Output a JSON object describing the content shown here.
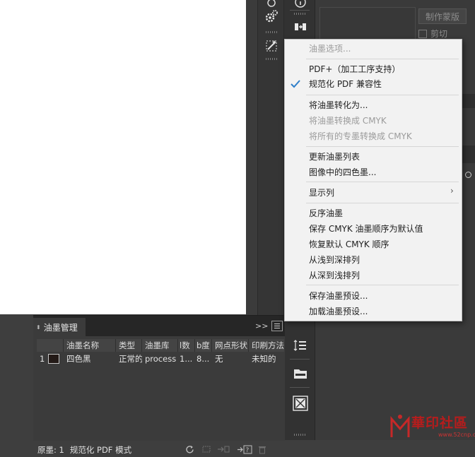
{
  "flyout_menu": {
    "items": [
      {
        "label": "油墨选项...",
        "enabled": false,
        "checked": false
      },
      {
        "label": "PDF+（加工工序支持）",
        "enabled": true,
        "checked": false
      },
      {
        "label": "规范化 PDF 兼容性",
        "enabled": true,
        "checked": true
      },
      {
        "label": "将油墨转化为...",
        "enabled": true,
        "checked": false
      },
      {
        "label": "将油墨转换成 CMYK",
        "enabled": false,
        "checked": false
      },
      {
        "label": "将所有的专墨转换成 CMYK",
        "enabled": false,
        "checked": false
      },
      {
        "label": "更新油墨列表",
        "enabled": true,
        "checked": false
      },
      {
        "label": "图像中的四色墨...",
        "enabled": true,
        "checked": false
      },
      {
        "label": "显示列",
        "enabled": true,
        "checked": false,
        "has_submenu": true
      },
      {
        "label": "反序油墨",
        "enabled": true,
        "checked": false
      },
      {
        "label": "保存 CMYK 油墨顺序为默认值",
        "enabled": true,
        "checked": false
      },
      {
        "label": "恢复默认 CMYK 顺序",
        "enabled": true,
        "checked": false
      },
      {
        "label": "从浅到深排列",
        "enabled": true,
        "checked": false
      },
      {
        "label": "从深到浅排列",
        "enabled": true,
        "checked": false
      },
      {
        "label": "保存油墨预设...",
        "enabled": true,
        "checked": false
      },
      {
        "label": "加载油墨预设...",
        "enabled": true,
        "checked": false
      }
    ]
  },
  "ink_panel": {
    "tab_title": "油墨管理",
    "collapse_glyph": ">>",
    "columns": [
      "油墨名称",
      "类型",
      "油墨库",
      "l数",
      "b度",
      "网点形状",
      "印刷方法"
    ],
    "rows": [
      {
        "index": "1",
        "swatch_color": "#231a17",
        "name": "四色黑",
        "type": "正常的",
        "library": "process",
        "c4": "1...",
        "c5": "8...",
        "dot_shape": "无",
        "method": "未知的"
      }
    ],
    "footer": {
      "original_label": "原墨: 1",
      "mode_label": "规范化 PDF 模式"
    }
  },
  "right_panel": {
    "mask_button": "制作蒙版",
    "cut_checkbox": "剪切",
    "cut_checked": false
  },
  "watermark": {
    "text": "華印社區",
    "url": "www.52cnp.com"
  },
  "colors": {
    "menu_bg": "#f2f2f2",
    "check_accent": "#2e7ec9",
    "panel_bg": "#3b3b3b",
    "watermark_red": "#b71c1c"
  }
}
